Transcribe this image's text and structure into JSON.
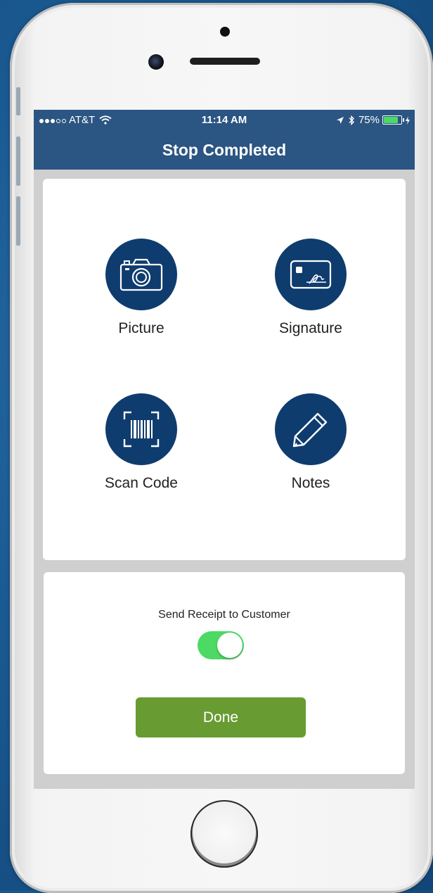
{
  "status_bar": {
    "carrier": "AT&T",
    "time": "11:14 AM",
    "battery": "75%",
    "battery_level": 0.75
  },
  "header": {
    "title": "Stop Completed"
  },
  "actions": [
    {
      "label": "Picture",
      "icon": "camera-icon"
    },
    {
      "label": "Signature",
      "icon": "signature-card-icon"
    },
    {
      "label": "Scan Code",
      "icon": "barcode-scan-icon"
    },
    {
      "label": "Notes",
      "icon": "pencil-icon"
    }
  ],
  "receipt": {
    "label": "Send Receipt to Customer",
    "toggle_on": true
  },
  "done_button": {
    "label": "Done"
  },
  "colors": {
    "navbar": "#2b5582",
    "icon_circle": "#0f3c6e",
    "toggle_on": "#4cd964",
    "done_button": "#689b32"
  }
}
